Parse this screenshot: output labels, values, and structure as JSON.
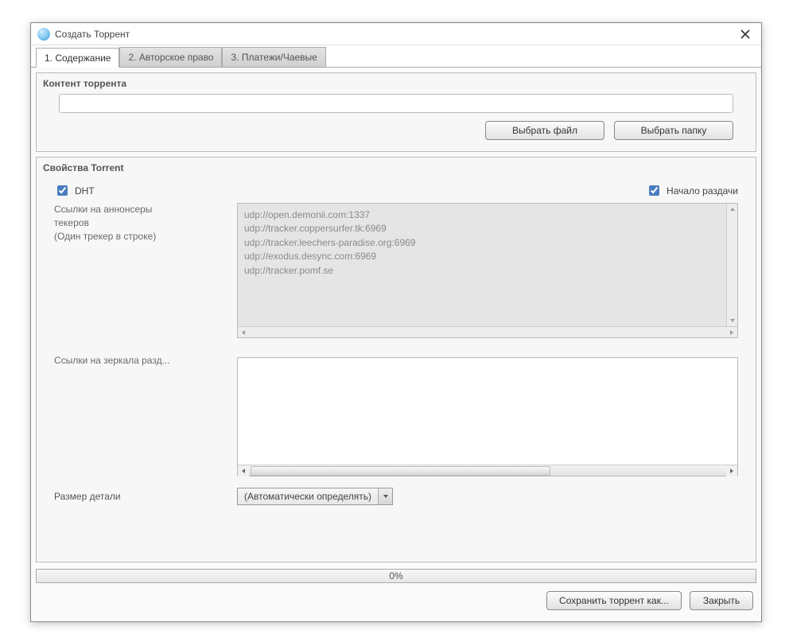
{
  "window": {
    "title": "Создать Торрент"
  },
  "tabs": {
    "t1": "1. Содержание",
    "t2": "2. Авторское право",
    "t3": "3. Платежи/Чаевые"
  },
  "content_group": {
    "title": "Контент торрента",
    "path_value": "",
    "choose_file": "Выбрать файл",
    "choose_folder": "Выбрать папку"
  },
  "props_group": {
    "title": "Свойства Torrent",
    "dht_label": "DHT",
    "dht_checked": true,
    "start_seeding_label": "Начало раздачи",
    "start_seeding_checked": true,
    "trackers_label_l1": "Ссылки на аннонсеры",
    "trackers_label_l2": "текеров",
    "trackers_label_l3": "(Один трекер в строке)",
    "trackers_value": "udp://open.demonii.com:1337\nudp://tracker.coppersurfer.tk:6969\nudp://tracker.leechers-paradise.org:6969\nudp://exodus.desync.com:6969\nudp://tracker.pomf.se",
    "mirrors_label": "Ссылки на зеркала разд...",
    "mirrors_value": "",
    "piece_label": "Размер детали",
    "piece_value": "(Автоматически определять)"
  },
  "progress": {
    "text": "0%"
  },
  "footer": {
    "save_as": "Сохранить торрент как...",
    "close": "Закрыть"
  }
}
